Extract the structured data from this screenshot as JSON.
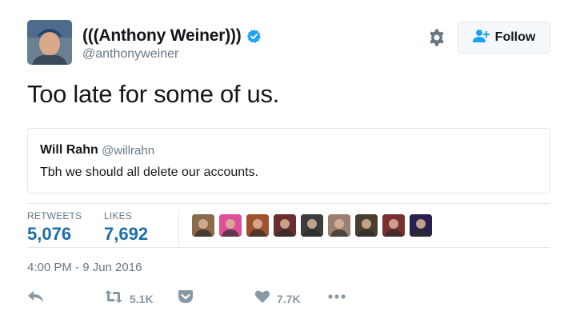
{
  "author": {
    "display_name": "(((Anthony Weiner)))",
    "handle": "@anthonyweiner",
    "verified_icon": "verified-badge-icon"
  },
  "header": {
    "follow_label": "Follow",
    "gear_icon": "gear-icon",
    "follow_icon": "add-user-icon"
  },
  "tweet": {
    "text": "Too late for some of us."
  },
  "quoted_tweet": {
    "name": "Will Rahn",
    "handle": "@willrahn",
    "text": "Tbh we should all delete our accounts."
  },
  "stats": {
    "retweets_label": "RETWEETS",
    "retweets_value": "5,076",
    "likes_label": "LIKES",
    "likes_value": "7,692"
  },
  "likers": [
    {
      "color": "#8a6a4a"
    },
    {
      "color": "#e0509a"
    },
    {
      "color": "#a0522d"
    },
    {
      "color": "#6b2e2e"
    },
    {
      "color": "#3c3c3c"
    },
    {
      "color": "#9a8070"
    },
    {
      "color": "#4a4030"
    },
    {
      "color": "#7a3030"
    },
    {
      "color": "#2a2050"
    }
  ],
  "timestamp": "4:00 PM - 9 Jun 2016",
  "actions": {
    "retweet_count": "5.1K",
    "like_count": "7.7K"
  },
  "colors": {
    "accent": "#1da1f2",
    "stat_value": "#1b6ea8",
    "muted": "#657786",
    "action": "#8899a6"
  }
}
